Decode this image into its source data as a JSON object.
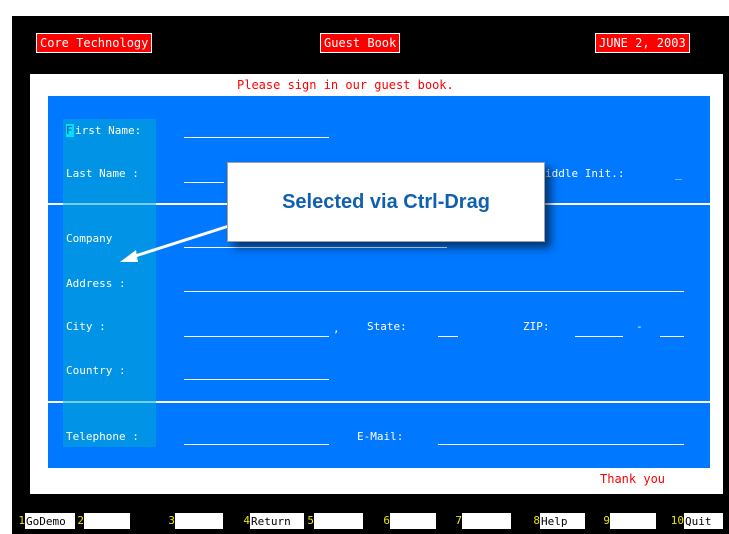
{
  "header": {
    "app_name": "Core Technology",
    "screen_title": "Guest Book",
    "date": "JUNE 2, 2003"
  },
  "form": {
    "prompt": "Please sign in our guest book.",
    "cursor_char": "F",
    "first_name_label": "irst Name:",
    "last_name_label": "Last Name :",
    "middle_init_label": "iddle Init.:",
    "middle_init_value": "_",
    "company_label": "Company",
    "address_label": "Address    :",
    "city_label": "City       :",
    "city_comma": ",",
    "state_label": "State:",
    "zip_label": "ZIP:",
    "zip_dash": "-",
    "country_label": "Country    :",
    "telephone_label": "Telephone :",
    "email_label": "E-Mail:",
    "footer_text": "Thank you"
  },
  "callout": {
    "text": "Selected via Ctrl-Drag"
  },
  "function_keys": [
    {
      "num": "1",
      "label": "GoDemo"
    },
    {
      "num": "2",
      "label": ""
    },
    {
      "num": "3",
      "label": ""
    },
    {
      "num": "4",
      "label": "Return"
    },
    {
      "num": "5",
      "label": ""
    },
    {
      "num": "6",
      "label": ""
    },
    {
      "num": "7",
      "label": ""
    },
    {
      "num": "8",
      "label": "Help"
    },
    {
      "num": "9",
      "label": ""
    },
    {
      "num": "10",
      "label": "Quit"
    }
  ],
  "colors": {
    "terminal_bg": "#000000",
    "form_bg": "#0078ff",
    "header_bg": "#ff0000",
    "prompt_text": "#ff0000",
    "callout_text": "#1060b0"
  }
}
